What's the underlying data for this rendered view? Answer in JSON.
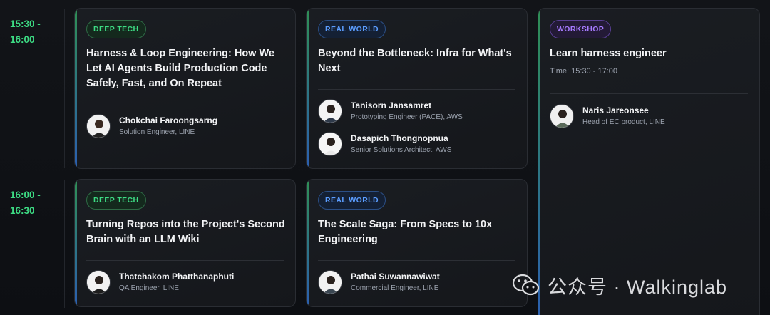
{
  "schedule": {
    "slots": [
      {
        "time_start": "15:30 -",
        "time_end": "16:00"
      },
      {
        "time_start": "16:00 -",
        "time_end": "16:30"
      }
    ],
    "cards": [
      {
        "badge": "DEEP TECH",
        "title": "Harness & Loop Engineering: How We Let AI Agents Build Production Code Safely, Fast, and On Repeat",
        "speakers": [
          {
            "name": "Chokchai Faroongsarng",
            "role": "Solution Engineer, LINE"
          }
        ]
      },
      {
        "badge": "REAL WORLD",
        "title": "Beyond the Bottleneck: Infra for What's Next",
        "speakers": [
          {
            "name": "Tanisorn Jansamret",
            "role": "Prototyping Engineer (PACE), AWS"
          },
          {
            "name": "Dasapich Thongnopnua",
            "role": "Senior Solutions Architect, AWS"
          }
        ]
      },
      {
        "badge": "WORKSHOP",
        "title": "Learn harness engineer",
        "meta": "Time: 15:30 - 17:00",
        "speakers": [
          {
            "name": "Naris Jareonsee",
            "role": "Head of EC product, LINE"
          }
        ]
      },
      {
        "badge": "DEEP TECH",
        "title": "Turning Repos into the Project's Second Brain with an LLM Wiki",
        "speakers": [
          {
            "name": "Thatchakom Phatthanaphuti",
            "role": "QA Engineer, LINE"
          }
        ]
      },
      {
        "badge": "REAL WORLD",
        "title": "The Scale Saga: From Specs to 10x Engineering",
        "speakers": [
          {
            "name": "Pathai Suwannawiwat",
            "role": "Commercial Engineer, LINE"
          }
        ]
      }
    ]
  },
  "watermark": {
    "text": "公众号 · Walkinglab",
    "icon": "wechat-icon"
  },
  "colors": {
    "deep_tech": "#3ddc84",
    "real_world": "#5b9dff",
    "workshop": "#a77bff",
    "time": "#3ddc84"
  }
}
